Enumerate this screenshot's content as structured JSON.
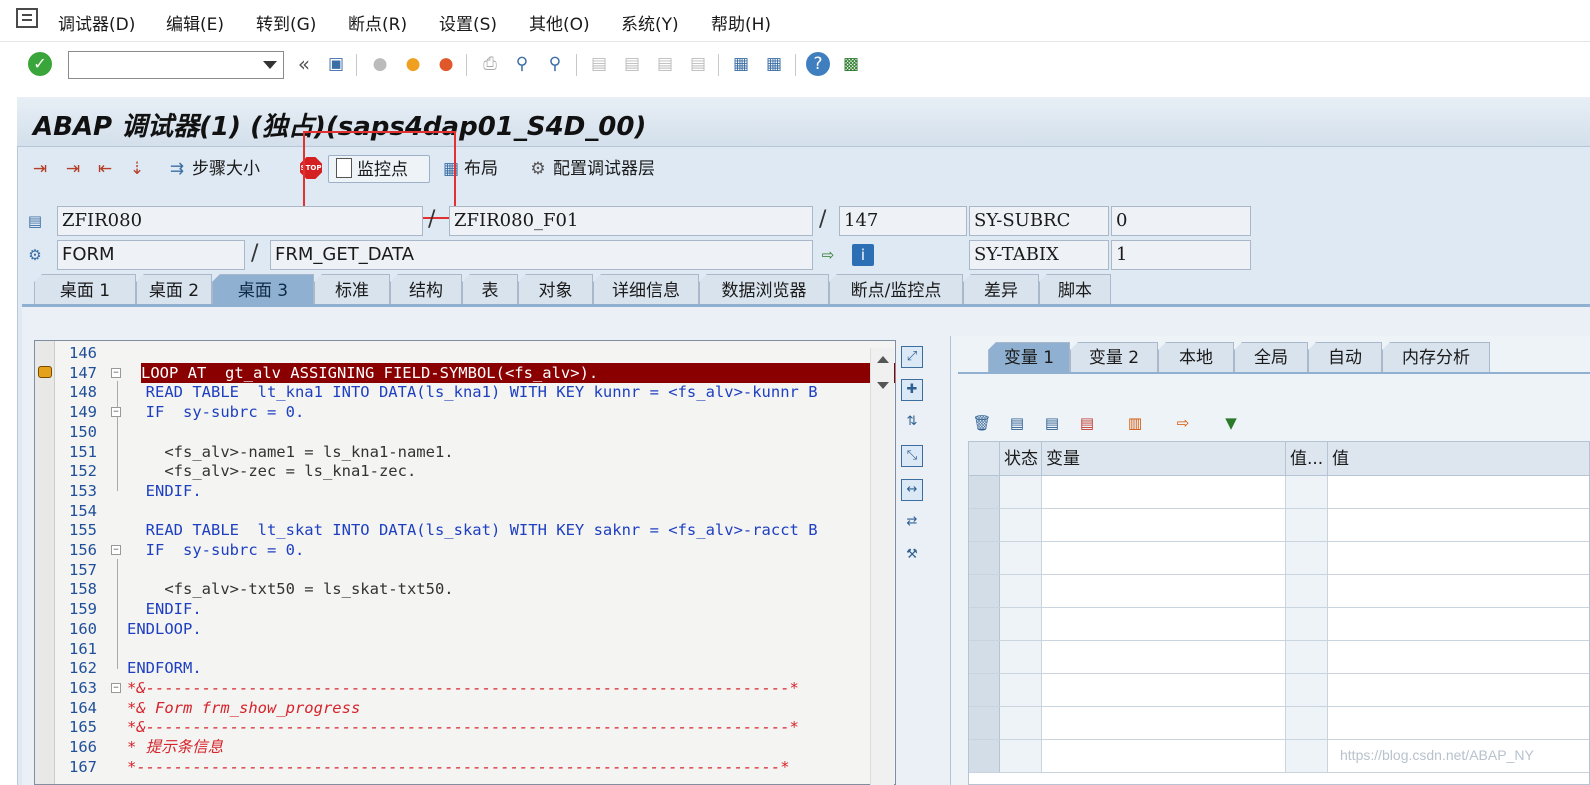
{
  "menubar": {
    "items": [
      "调试器(D)",
      "编辑(E)",
      "转到(G)",
      "断点(R)",
      "设置(S)",
      "其他(O)",
      "系统(Y)",
      "帮助(H)"
    ]
  },
  "system_toolbar": {
    "command_value": "",
    "icons": [
      "ok-icon",
      "back-arrows-icon",
      "save-icon",
      "nav-back-icon",
      "exit-icon",
      "cancel-icon",
      "print-icon",
      "find-icon",
      "find-next-icon",
      "first-page-icon",
      "prev-page-icon",
      "next-page-icon",
      "last-page-icon",
      "new-session-icon",
      "shortcut-icon",
      "help-icon",
      "layout-icon"
    ]
  },
  "title": "ABAP 调试器(1) (独占)(saps4dap01_S4D_00)",
  "app_toolbar": {
    "step_size": "步骤大小",
    "watchpoint": "监控点",
    "layout": "布局",
    "config_layer": "配置调试器层",
    "stop_text": "STOP"
  },
  "info": {
    "program": "ZFIR080",
    "include": "ZFIR080_F01",
    "line": "147",
    "sys_field_1": "SY-SUBRC",
    "sys_value_1": "0",
    "event_type": "FORM",
    "event_name": "FRM_GET_DATA",
    "sys_field_2": "SY-TABIX",
    "sys_value_2": "1",
    "slash": "/"
  },
  "tabs": [
    "桌面 1",
    "桌面 2",
    "桌面 3",
    "标准",
    "结构",
    "表",
    "对象",
    "详细信息",
    "数据浏览器",
    "断点/监控点",
    "差异",
    "脚本"
  ],
  "active_tab": "桌面 3",
  "code": [
    {
      "ln": "146",
      "text": "",
      "type": "plain"
    },
    {
      "ln": "147",
      "text": "LOOP AT  gt_alv ASSIGNING FIELD-SYMBOL(<fs_alv>).",
      "type": "current"
    },
    {
      "ln": "148",
      "text": "  READ TABLE  lt_kna1 INTO DATA(ls_kna1) WITH KEY kunnr = <fs_alv>-kunnr B",
      "type": "kw"
    },
    {
      "ln": "149",
      "text": "  IF  sy-subrc = 0.",
      "type": "kw"
    },
    {
      "ln": "150",
      "text": "",
      "type": "plain"
    },
    {
      "ln": "151",
      "text": "    <fs_alv>-name1 = ls_kna1-name1.",
      "type": "plain"
    },
    {
      "ln": "152",
      "text": "    <fs_alv>-zec = ls_kna1-zec.",
      "type": "plain"
    },
    {
      "ln": "153",
      "text": "  ENDIF.",
      "type": "kw"
    },
    {
      "ln": "154",
      "text": "",
      "type": "plain"
    },
    {
      "ln": "155",
      "text": "  READ TABLE  lt_skat INTO DATA(ls_skat) WITH KEY saknr = <fs_alv>-racct B",
      "type": "kw"
    },
    {
      "ln": "156",
      "text": "  IF  sy-subrc = 0.",
      "type": "kw"
    },
    {
      "ln": "157",
      "text": "",
      "type": "plain"
    },
    {
      "ln": "158",
      "text": "    <fs_alv>-txt50 = ls_skat-txt50.",
      "type": "plain"
    },
    {
      "ln": "159",
      "text": "  ENDIF.",
      "type": "kw"
    },
    {
      "ln": "160",
      "text": "ENDLOOP.",
      "type": "kw"
    },
    {
      "ln": "161",
      "text": "",
      "type": "plain"
    },
    {
      "ln": "162",
      "text": "ENDFORM.",
      "type": "kw"
    },
    {
      "ln": "163",
      "text": "*&---------------------------------------------------------------------*",
      "type": "cm"
    },
    {
      "ln": "164",
      "text": "*& Form frm_show_progress",
      "type": "cm"
    },
    {
      "ln": "165",
      "text": "*&---------------------------------------------------------------------*",
      "type": "cm"
    },
    {
      "ln": "166",
      "text": "* 提示条信息",
      "type": "cm"
    },
    {
      "ln": "167",
      "text": "*---------------------------------------------------------------------*",
      "type": "cm"
    }
  ],
  "var_tabs": [
    "变量 1",
    "变量 2",
    "本地",
    "全局",
    "自动",
    "内存分析"
  ],
  "var_active_tab": "变量 1",
  "var_table": {
    "headers": [
      "状态",
      "变量",
      "值...",
      "值"
    ],
    "rows": 9
  },
  "watermark": "https://blog.csdn.net/ABAP_NY"
}
